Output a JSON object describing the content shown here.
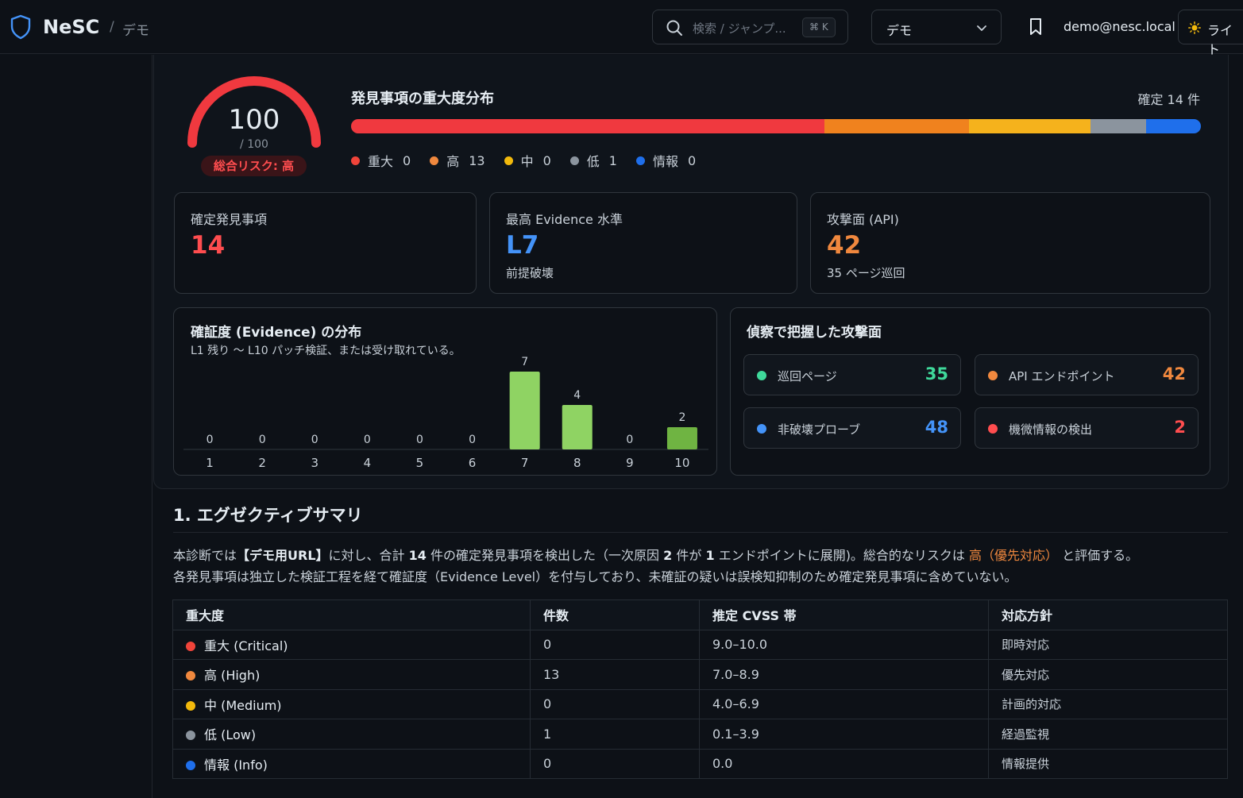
{
  "header": {
    "brand": "NeSC",
    "breadcrumb_sep": "/",
    "breadcrumb": "デモ",
    "search_placeholder": "検索 / ジャンプ...",
    "search_shortcut": "⌘ K",
    "project_select": "デモ",
    "user": "demo@nesc.local",
    "theme_label": "ライト"
  },
  "summary": {
    "score": "100",
    "score_max": "/ 100",
    "score_value": 100,
    "risk_label": "総合リスク: 高",
    "distribution_title": "発見事項の重大度分布",
    "distribution_total": "確定 14 件",
    "severity": [
      {
        "label": "重大",
        "count": "0",
        "color": "#f0443a",
        "share": 0
      },
      {
        "label": "高",
        "count": "13",
        "color": "#f0883e",
        "share": 0
      },
      {
        "label": "中",
        "count": "0",
        "color": "#f2b90c",
        "share": 0
      },
      {
        "label": "低",
        "count": "1",
        "color": "#8b949e",
        "share": 0
      },
      {
        "label": "情報",
        "count": "0",
        "color": "#1f6feb",
        "share": 0
      }
    ],
    "bar_colors": [
      "#f0393f",
      "#f0821e",
      "#f5b21c",
      "#8b949e",
      "#1f6feb"
    ]
  },
  "cards": {
    "findings": {
      "label": "確定発見事項",
      "value": "14",
      "color": "#ff4d4f"
    },
    "evidence": {
      "label": "最高 Evidence 水準",
      "value": "L7",
      "sub": "前提破壊",
      "color": "#4493f8"
    },
    "surface": {
      "label": "攻撃面 (API)",
      "value": "42",
      "sub": "35 ページ巡回",
      "color": "#f0883e"
    }
  },
  "chart_data": {
    "type": "bar",
    "title": "確証度 (Evidence) の分布",
    "subtitle": "L1 残り 〜 L10 パッチ検証、または受け取れている。",
    "categories": [
      "1",
      "2",
      "3",
      "4",
      "5",
      "6",
      "7",
      "8",
      "9",
      "10"
    ],
    "values": [
      0,
      0,
      0,
      0,
      0,
      0,
      7,
      4,
      0,
      2
    ],
    "ylim": [
      0,
      7
    ],
    "colors": {
      "default": "#8fd363",
      "highlight": "#6fb442"
    }
  },
  "recon": {
    "title": "偵察で把握した攻撃面",
    "tiles": [
      {
        "label": "巡回ページ",
        "value": "35",
        "color": "#3fd99b"
      },
      {
        "label": "API エンドポイント",
        "value": "42",
        "color": "#f0883e"
      },
      {
        "label": "非破壊プローブ",
        "value": "48",
        "color": "#4493f8"
      },
      {
        "label": "機微情報の検出",
        "value": "2",
        "color": "#ff4d4f"
      }
    ]
  },
  "exec_summary": {
    "title": "1.  エグゼクティブサマリ",
    "p1_a": "本診断では",
    "p1_b": "【デモ用URL】",
    "p1_c": "に対し、合計",
    "p1_d": "14",
    "p1_e": "件の確定発見事項を検出した（一次原因",
    "p1_f": "2",
    "p1_g": "件が",
    "p1_h": "1",
    "p1_i": "エンドポイントに展開)。総合的なリスクは",
    "p1_j": "高（優先対応）",
    "p1_k": "と評価する。",
    "p2": "各発見事項は独立した検証工程を経て確証度（Evidence Level）を付与しており、未確証の疑いは誤検知抑制のため確定発見事項に含めていない。"
  },
  "table": {
    "headers": [
      "重大度",
      "件数",
      "推定 CVSS 帯",
      "対応方針"
    ],
    "rows": [
      {
        "severity": "重大 (Critical)",
        "count": "0",
        "cvss": "9.0–10.0",
        "action": "即時対応",
        "color": "#f0443a"
      },
      {
        "severity": "高 (High)",
        "count": "13",
        "cvss": "7.0–8.9",
        "action": "優先対応",
        "color": "#f0883e"
      },
      {
        "severity": "中 (Medium)",
        "count": "0",
        "cvss": "4.0–6.9",
        "action": "計画的対応",
        "color": "#f2b90c"
      },
      {
        "severity": "低 (Low)",
        "count": "1",
        "cvss": "0.1–3.9",
        "action": "経過監視",
        "color": "#8b949e"
      },
      {
        "severity": "情報 (Info)",
        "count": "0",
        "cvss": "0.0",
        "action": "情報提供",
        "color": "#1f6feb"
      }
    ]
  }
}
